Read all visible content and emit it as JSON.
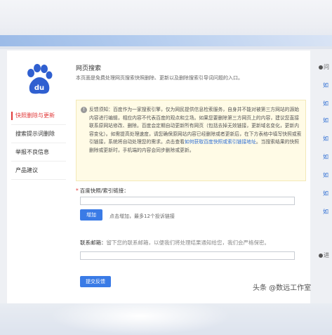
{
  "sidebar": {
    "items": [
      {
        "label": "快照删除与更新",
        "active": true
      },
      {
        "label": "搜索提示词删除",
        "active": false
      },
      {
        "label": "举报不良信息",
        "active": false
      },
      {
        "label": "产品建议",
        "active": false
      }
    ]
  },
  "logo": {
    "text": "du"
  },
  "main": {
    "title": "网页搜索",
    "description": "本页面是免费处理网页搜索快照删除、更新以及删除搜索引导词问题的入口。",
    "notice": {
      "icon": "info-icon",
      "text_before_link": "反馈须知：百度作为一家搜索引擎，仅为网民提供信息检索服务，自身并不能对被第三方网站的源始内容进行编辑，相应内容不代表百度的观点和立场。如果您要删除第三方网页上的内容，建议您直接联系原网站修改、删除。百度会定期自动更新所有网页（包括去掉无效链接，更新域名变化，更新内容变化）。如需提高处理速度，请您确保原网站内容已经删除或者更新后，在下方表格中填写快照或索引链接，系统将自动处理您的需求。点击查看",
      "link_text": "如何获取百度快照或索引链接地址",
      "text_after_link": "。当搜索结果的快照删除或更新时，手机端的内容会同步删除或更新。"
    },
    "url_field": {
      "required_mark": "*",
      "label": "百度快照/索引链接：",
      "value": ""
    },
    "add_button": "增加",
    "add_hint": "点击增加，最多12个投诉链接",
    "email_field": {
      "label": "联系邮箱：",
      "hint": "留下您的联系邮箱，以便我们将处理结果通知给您，我们会严格保密。",
      "value": ""
    },
    "submit_button": "提交反馈"
  },
  "right_column": {
    "head1": "问",
    "links": [
      "如",
      "如",
      "如",
      "如",
      "如",
      "如",
      "如",
      "如"
    ],
    "head2": "进"
  },
  "watermark": "头条 @数远工作室"
}
